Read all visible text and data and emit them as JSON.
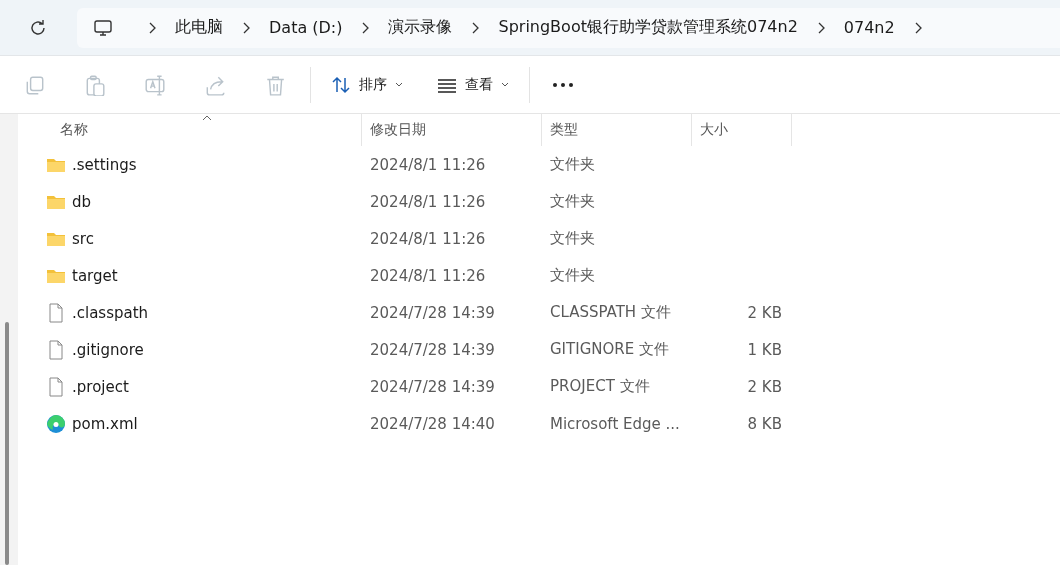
{
  "breadcrumbs": [
    "此电脑",
    "Data (D:)",
    "演示录像",
    "SpringBoot银行助学贷款管理系统074n2",
    "074n2"
  ],
  "toolbar": {
    "actions": [
      {
        "kind": "copy",
        "disabled": true
      },
      {
        "kind": "paste",
        "disabled": true
      },
      {
        "kind": "rename",
        "disabled": true
      },
      {
        "kind": "share",
        "disabled": true
      },
      {
        "kind": "delete",
        "disabled": true
      }
    ],
    "menus": [
      {
        "kind": "sort",
        "label": "排序"
      },
      {
        "kind": "view",
        "label": "查看"
      }
    ]
  },
  "table": {
    "columns": [
      "名称",
      "修改日期",
      "类型",
      "大小"
    ],
    "rows": [
      {
        "kind": "folder",
        "name": ".settings",
        "modified": "2024/8/1 11:26",
        "type": "文件夹"
      },
      {
        "kind": "folder",
        "name": "db",
        "modified": "2024/8/1 11:26",
        "type": "文件夹"
      },
      {
        "kind": "folder",
        "name": "src",
        "modified": "2024/8/1 11:26",
        "type": "文件夹"
      },
      {
        "kind": "folder",
        "name": "target",
        "modified": "2024/8/1 11:26",
        "type": "文件夹"
      },
      {
        "kind": "file",
        "name": ".classpath",
        "modified": "2024/7/28 14:39",
        "type": "CLASSPATH 文件",
        "size": "2 KB"
      },
      {
        "kind": "file",
        "name": ".gitignore",
        "modified": "2024/7/28 14:39",
        "type": "GITIGNORE 文件",
        "size": "1 KB"
      },
      {
        "kind": "file",
        "name": ".project",
        "modified": "2024/7/28 14:39",
        "type": "PROJECT 文件",
        "size": "2 KB"
      },
      {
        "kind": "edge",
        "name": "pom.xml",
        "modified": "2024/7/28 14:40",
        "type": "Microsoft Edge ...",
        "size": "8 KB"
      }
    ]
  }
}
